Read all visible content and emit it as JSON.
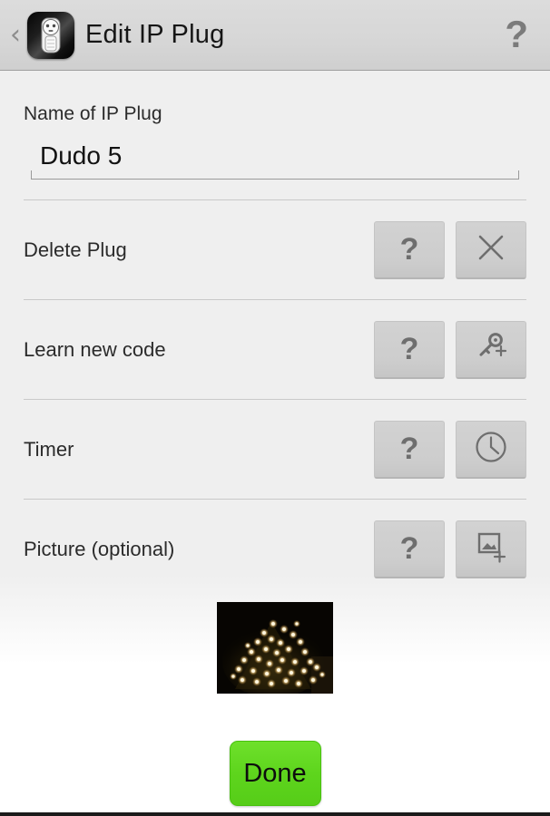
{
  "header": {
    "back_label": "‹",
    "app_icon_name": "ip-plug-app-icon",
    "title": "Edit IP Plug",
    "help_label": "?"
  },
  "form": {
    "name_field": {
      "label": "Name of IP Plug",
      "value": "Dudo 5",
      "placeholder": "Name of IP Plug"
    },
    "rows": [
      {
        "label": "Delete Plug",
        "help_label": "?",
        "action_icon": "close-x-icon"
      },
      {
        "label": "Learn new code",
        "help_label": "?",
        "action_icon": "key-plus-icon"
      },
      {
        "label": "Timer",
        "help_label": "?",
        "action_icon": "clock-icon"
      },
      {
        "label": "Picture (optional)",
        "help_label": "?",
        "action_icon": "image-plus-icon"
      }
    ]
  },
  "picture": {
    "alt": "Night photo of a tree covered in warm string lights"
  },
  "footer": {
    "done_label": "Done"
  },
  "colors": {
    "accent_green": "#5ed51d",
    "appbar": "#d6d6d6",
    "page_bg": "#efefef",
    "icon_gray": "#6e6e6e",
    "divider": "#c9c9c9"
  }
}
